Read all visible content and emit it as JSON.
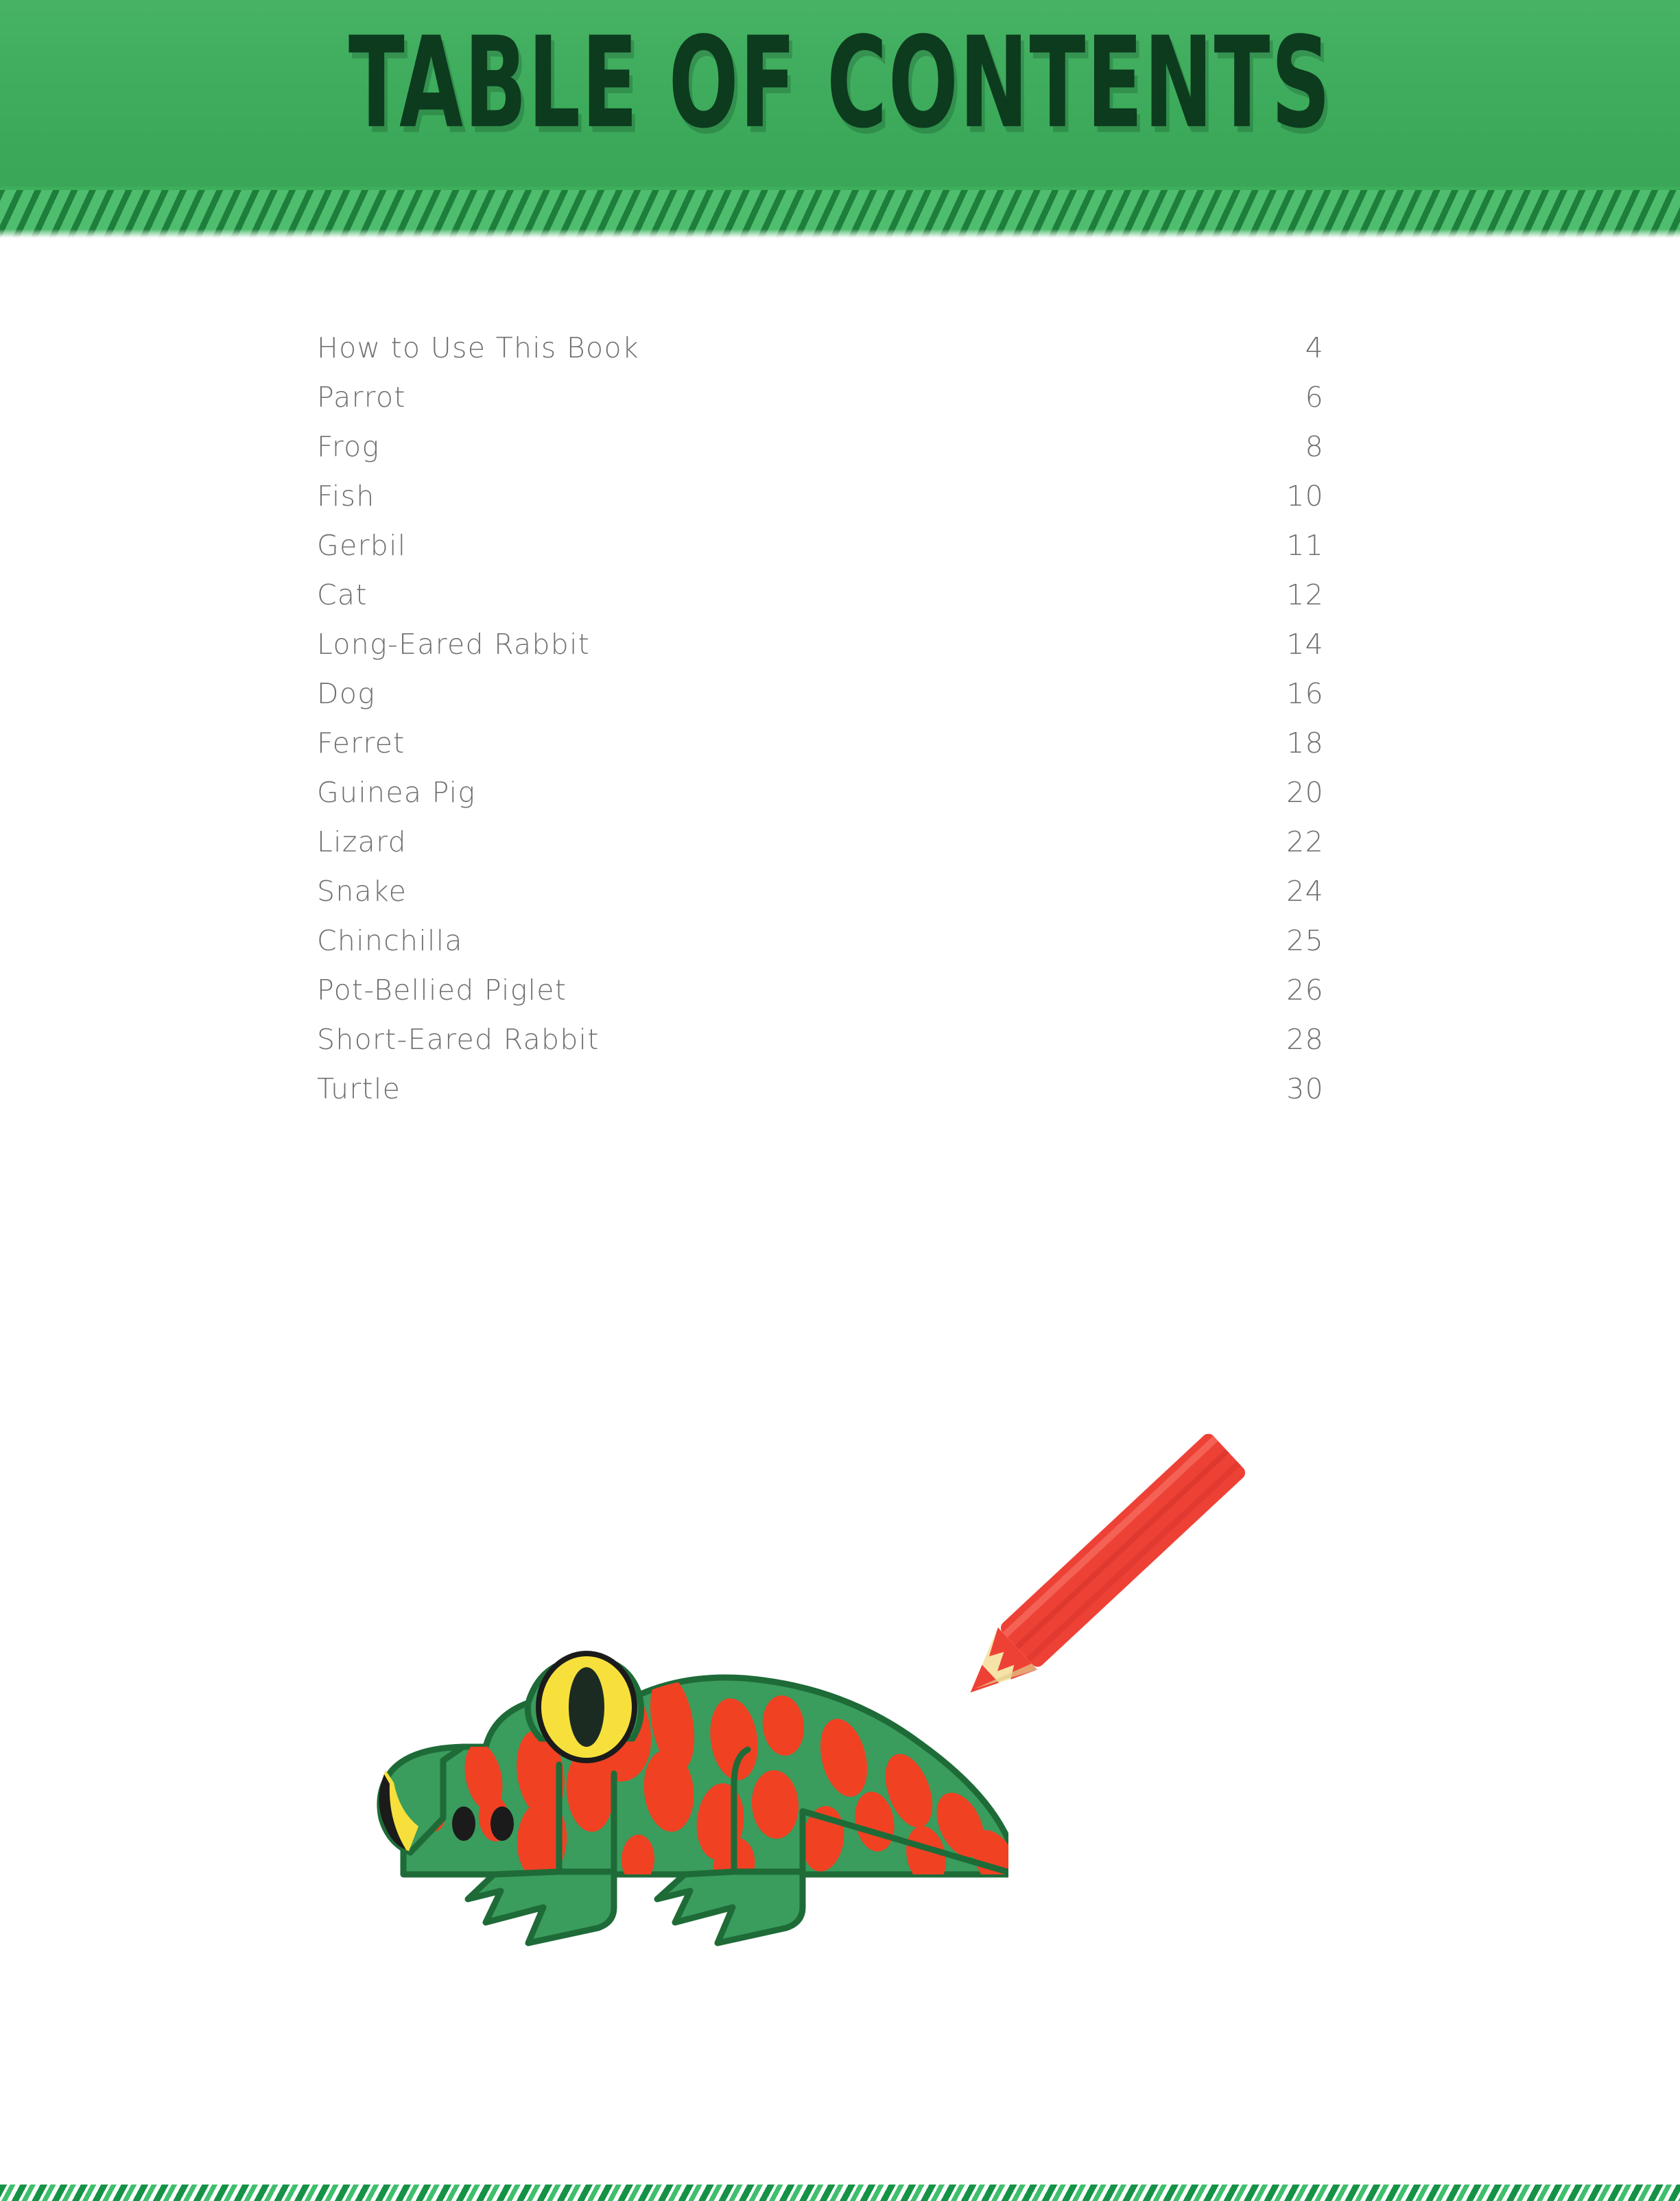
{
  "page": {
    "title": "TABLE OF CONTENTS",
    "background_color": "#ffffff"
  },
  "header": {
    "title": "TABLE OF CONTENTS",
    "band_color": "#3DAE5C",
    "title_color": "#0D3B1E",
    "stripe_dark": "#1E7E3C",
    "stripe_light": "#4EBD6E"
  },
  "toc": {
    "leader_style": "dotted",
    "text_color": "#6E7071",
    "entries": [
      {
        "label": "How to Use This Book",
        "page": "4"
      },
      {
        "label": "Parrot",
        "page": "6"
      },
      {
        "label": "Frog",
        "page": "8"
      },
      {
        "label": "Fish",
        "page": "10"
      },
      {
        "label": "Gerbil",
        "page": "11"
      },
      {
        "label": "Cat",
        "page": "12"
      },
      {
        "label": "Long-Eared Rabbit",
        "page": "14"
      },
      {
        "label": "Dog",
        "page": "16"
      },
      {
        "label": "Ferret",
        "page": "18"
      },
      {
        "label": "Guinea Pig",
        "page": "20"
      },
      {
        "label": "Lizard",
        "page": "22"
      },
      {
        "label": "Snake",
        "page": "24"
      },
      {
        "label": "Chinchilla",
        "page": "25"
      },
      {
        "label": "Pot-Bellied Piglet",
        "page": "26"
      },
      {
        "label": "Short-Eared Rabbit",
        "page": "28"
      },
      {
        "label": "Turtle",
        "page": "30"
      }
    ]
  },
  "artwork": {
    "frog": {
      "name": "frog-illustration",
      "body_color": "#3A9C5D",
      "outline_color": "#1E6B38",
      "spot_color": "#F04123",
      "eye_ring_color": "#F7E03C",
      "pupil_color": "#1B1B1B",
      "snout_marking_color": "#F7E03C"
    },
    "pencil": {
      "name": "red-colored-pencil",
      "barrel_color": "#EE4136",
      "barrel_shade_color": "#D6342B",
      "wood_color": "#F5E3A8",
      "tip_color": "#EE4136"
    }
  },
  "footer": {
    "stripe_dark": "#159246",
    "stripe_light": "#3FBF6C"
  }
}
